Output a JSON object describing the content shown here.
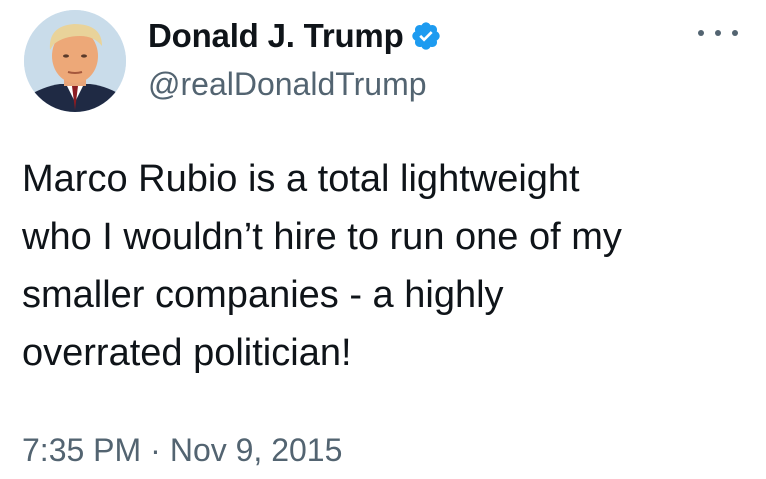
{
  "author": {
    "display_name": "Donald J. Trump",
    "handle": "@realDonaldTrump",
    "verified": true,
    "verified_badge_color": "#1d9bf0"
  },
  "tweet": {
    "text": "Marco Rubio is a total lightweight\nwho I wouldn’t hire to run one of my\nsmaller companies - a highly\noverrated politician!",
    "time": "7:35 PM",
    "separator": "·",
    "date": "Nov 9, 2015"
  },
  "icons": {
    "more": "more-options-icon",
    "verified": "verified-badge-icon"
  },
  "colors": {
    "text_primary": "#0f1419",
    "text_secondary": "#536471",
    "background": "#ffffff"
  }
}
